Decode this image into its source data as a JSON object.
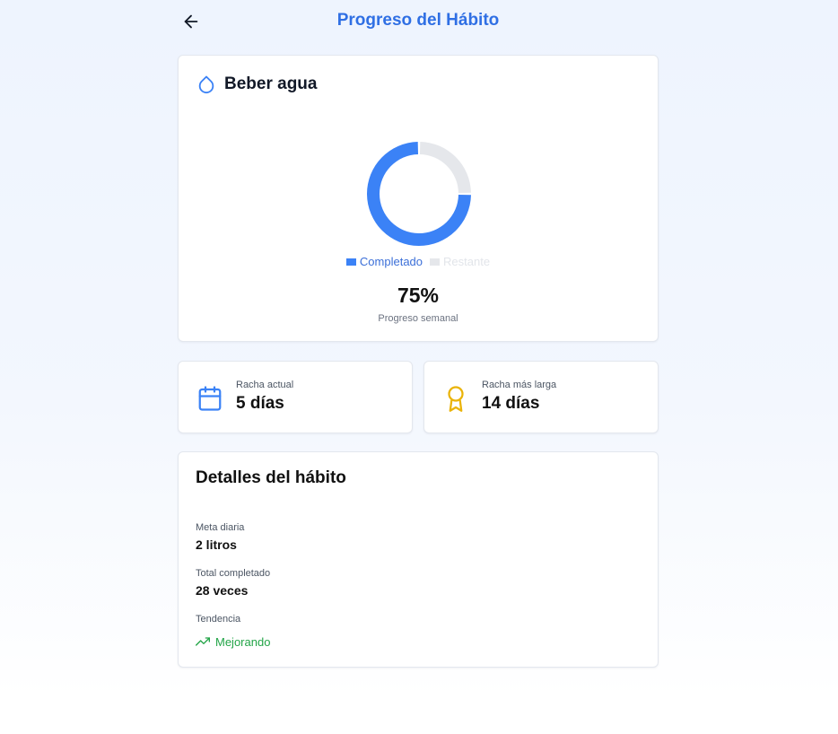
{
  "header": {
    "title": "Progreso del Hábito",
    "back_icon": "arrow-left-icon"
  },
  "habit": {
    "icon": "water-drop-icon",
    "name": "Beber agua"
  },
  "chart_data": {
    "type": "pie",
    "variant": "donut",
    "categories": [
      "Completado",
      "Restante"
    ],
    "values": [
      75,
      25
    ],
    "colors": [
      "#3b82f6",
      "#e5e7eb"
    ],
    "legend_position": "bottom"
  },
  "progress": {
    "value_label": "75%",
    "caption": "Progreso semanal"
  },
  "stats": {
    "current_streak": {
      "icon": "calendar-icon",
      "label": "Racha actual",
      "value": "5 días",
      "color": "#3b82f6"
    },
    "longest_streak": {
      "icon": "award-ribbon-icon",
      "label": "Racha más larga",
      "value": "14 días",
      "color": "#eab308"
    }
  },
  "details": {
    "title": "Detalles del hábito",
    "daily_goal_label": "Meta diaria",
    "daily_goal_value": "2 litros",
    "total_completed_label": "Total completado",
    "total_completed_value": "28 veces",
    "trend_label": "Tendencia",
    "trend_value": "Mejorando",
    "trend_icon": "trending-up-icon",
    "trend_color": "#22a447"
  },
  "colors": {
    "accent": "#2f6fe4",
    "completed": "#3b82f6",
    "remaining": "#e5e7eb"
  }
}
